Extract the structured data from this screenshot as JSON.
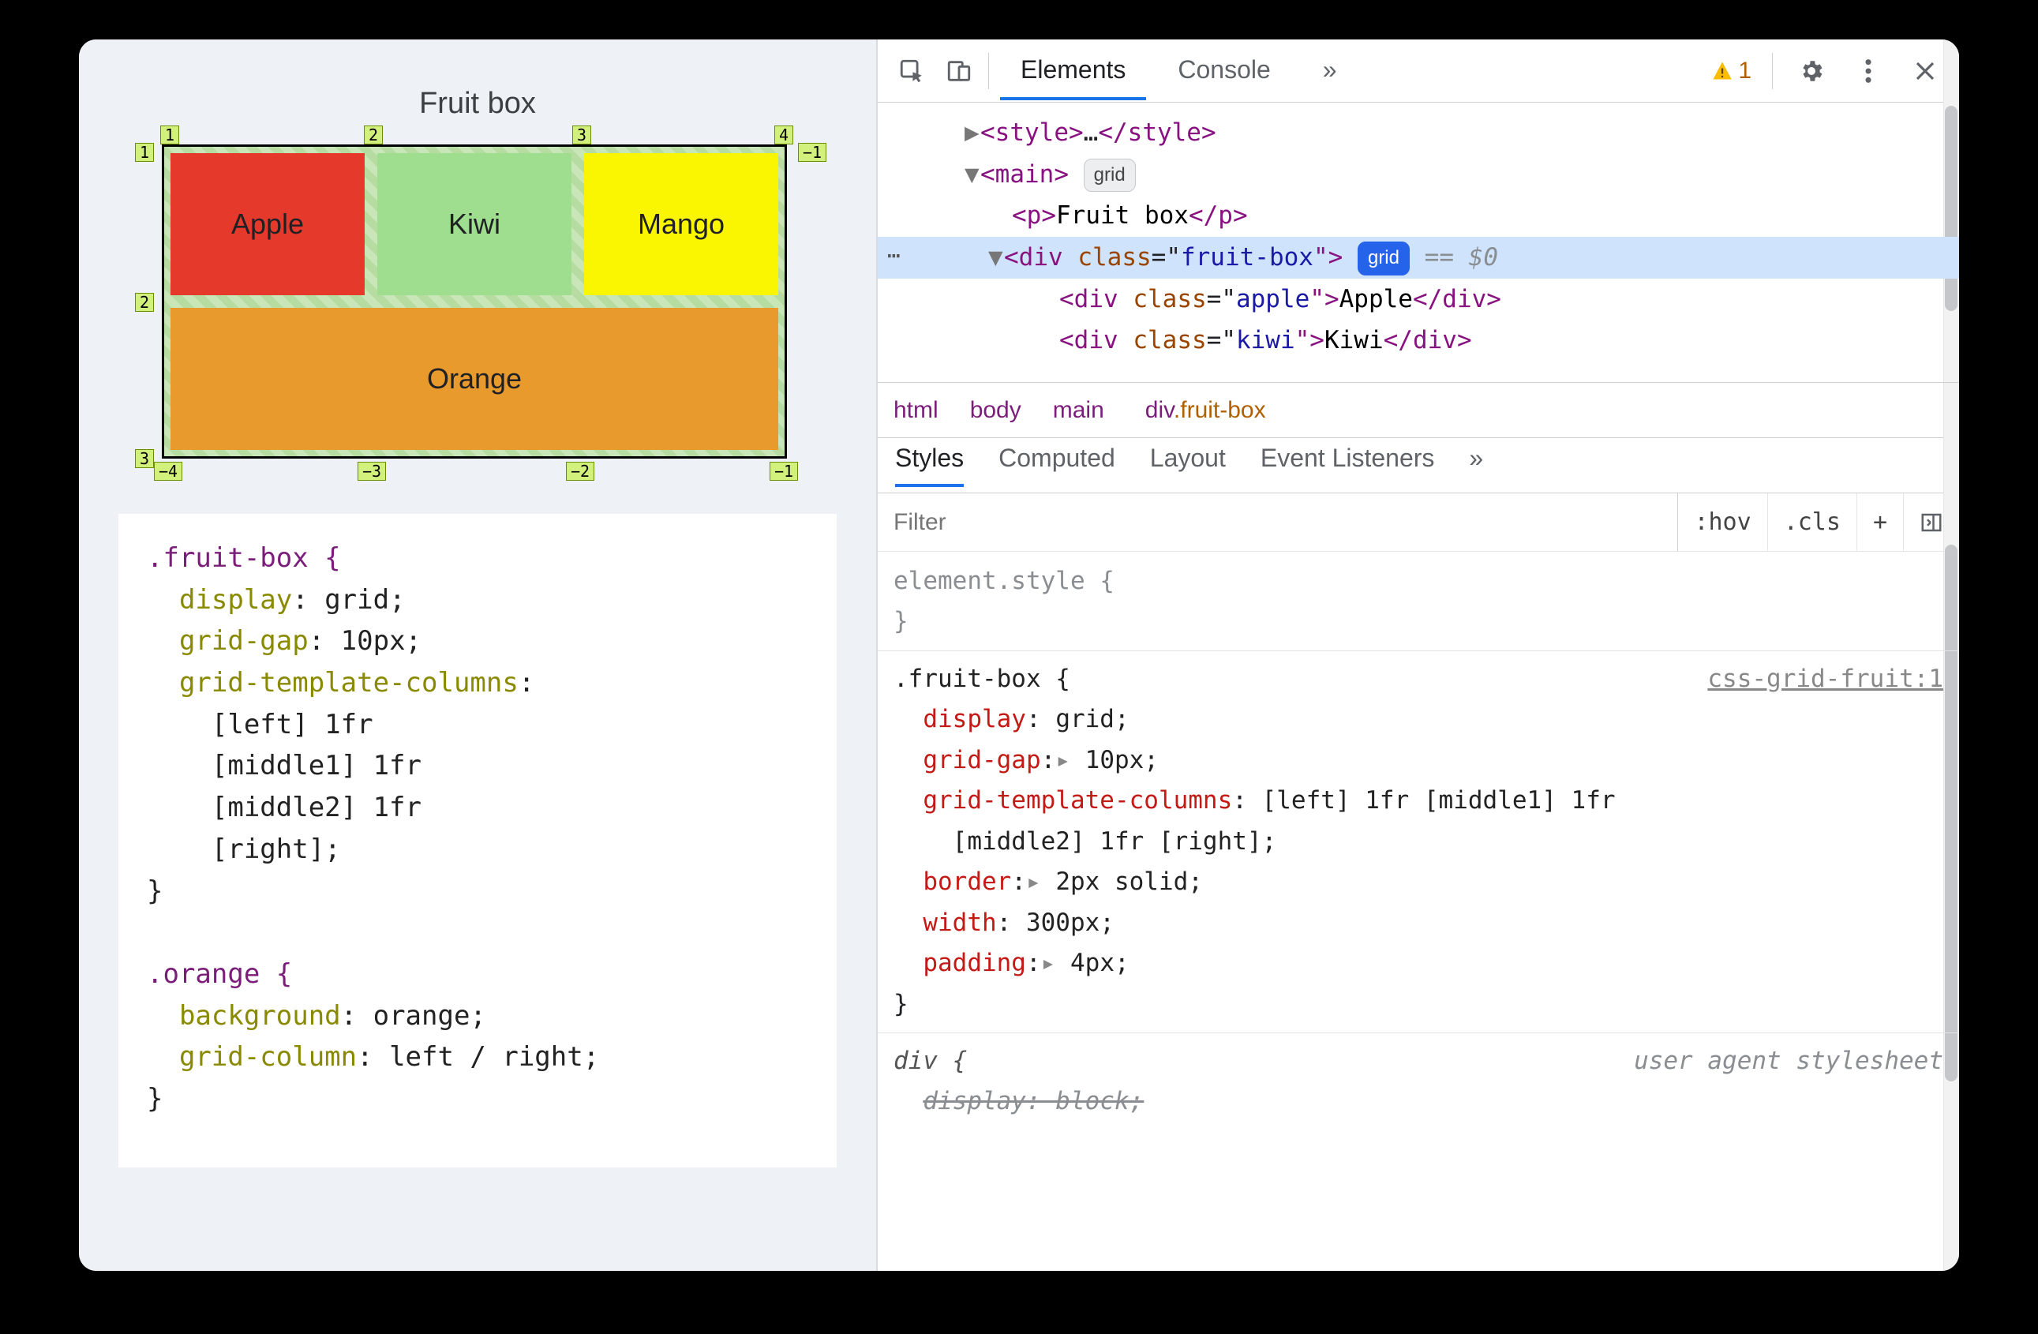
{
  "page": {
    "title": "Fruit box"
  },
  "fruits": {
    "apple": "Apple",
    "kiwi": "Kiwi",
    "mango": "Mango",
    "orange": "Orange"
  },
  "grid_labels": {
    "top": [
      "1",
      "2",
      "3",
      "4"
    ],
    "bottom": [
      "−4",
      "−3",
      "−2",
      "−1"
    ],
    "left": [
      "1",
      "2",
      "3"
    ],
    "right": [
      "−1"
    ]
  },
  "editor_css": {
    "rule1_sel": ".fruit-box {",
    "rule1_props": [
      {
        "k": "display",
        "v": "grid;"
      },
      {
        "k": "grid-gap",
        "v": "10px;"
      },
      {
        "k": "grid-template-columns",
        "v": ""
      }
    ],
    "rule1_cols": [
      "[left] 1fr",
      "[middle1] 1fr",
      "[middle2] 1fr",
      "[right];"
    ],
    "rule2_sel": ".orange {",
    "rule2_props": [
      {
        "k": "background",
        "v": "orange;"
      },
      {
        "k": "grid-column",
        "v": "left / right;"
      }
    ],
    "brace": "}"
  },
  "devtools": {
    "tabs": {
      "elements": "Elements",
      "console": "Console",
      "more": "»"
    },
    "warn_count": "1",
    "dom": {
      "style_open": "<style>",
      "style_ell": "…",
      "style_close": "</style>",
      "main": "<main>",
      "main_badge": "grid",
      "p_open": "<p>",
      "p_text": "Fruit box",
      "p_close": "</p>",
      "fb_open": "<div class=\"fruit-box\">",
      "fb_badge": "grid",
      "eq0": "== $0",
      "apple": "<div class=\"apple\">Apple</div>",
      "kiwi": "<div class=\"kiwi\">Kiwi</div>"
    },
    "breadcrumb": [
      "html",
      "body",
      "main",
      "div.fruit-box"
    ],
    "subtabs": [
      "Styles",
      "Computed",
      "Layout",
      "Event Listeners",
      "»"
    ],
    "filter": {
      "placeholder": "Filter",
      "hov": ":hov",
      "cls": ".cls",
      "plus": "+"
    },
    "styles": {
      "element_style": "element.style {",
      "close": "}",
      "source": "css-grid-fruit:1",
      "rule_sel": ".fruit-box {",
      "props": {
        "display": {
          "k": "display",
          "tri": "",
          "v": "grid;"
        },
        "gap": {
          "k": "grid-gap",
          "tri": "▸",
          "v": "10px;"
        },
        "cols": {
          "k": "grid-template-columns",
          "tri": "",
          "v": "[left] 1fr [middle1] 1fr"
        },
        "cols2": "    [middle2] 1fr [right];",
        "border": {
          "k": "border",
          "tri": "▸",
          "v": "2px solid;"
        },
        "width": {
          "k": "width",
          "tri": "",
          "v": "300px;"
        },
        "padding": {
          "k": "padding",
          "tri": "▸",
          "v": "4px;"
        }
      },
      "ua_label": "user agent stylesheet",
      "ua_sel": "div {",
      "ua_prop": "display: block;"
    }
  }
}
